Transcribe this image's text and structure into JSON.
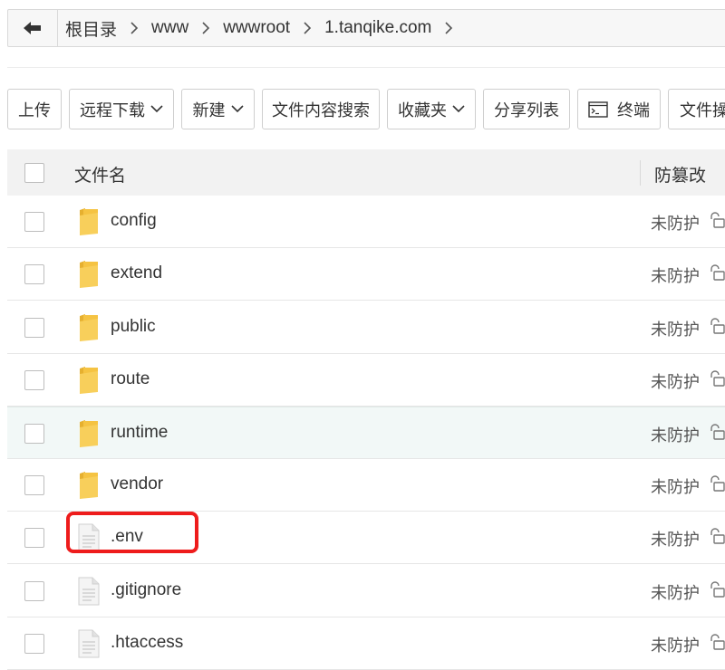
{
  "breadcrumb": {
    "items": [
      "根目录",
      "www",
      "wwwroot",
      "1.tanqike.com"
    ]
  },
  "toolbar": {
    "upload": "上传",
    "remote_download": "远程下载",
    "new": "新建",
    "content_search": "文件内容搜索",
    "favorites": "收藏夹",
    "share_list": "分享列表",
    "terminal": "终端",
    "file_op": "文件操"
  },
  "table": {
    "col_name": "文件名",
    "col_protect": "防篡改",
    "rows": [
      {
        "name": "config",
        "type": "folder",
        "protect": "未防护"
      },
      {
        "name": "extend",
        "type": "folder",
        "protect": "未防护"
      },
      {
        "name": "public",
        "type": "folder",
        "protect": "未防护"
      },
      {
        "name": "route",
        "type": "folder",
        "protect": "未防护"
      },
      {
        "name": "runtime",
        "type": "folder",
        "protect": "未防护"
      },
      {
        "name": "vendor",
        "type": "folder",
        "protect": "未防护"
      },
      {
        "name": ".env",
        "type": "file",
        "protect": "未防护"
      },
      {
        "name": ".gitignore",
        "type": "file",
        "protect": "未防护"
      },
      {
        "name": ".htaccess",
        "type": "file",
        "protect": "未防护"
      }
    ]
  },
  "colors": {
    "highlight": "#ee1c1c",
    "hover_row": "#f2f8f7",
    "folder": "#f5c342"
  },
  "icons": [
    "back-arrow-icon",
    "chevron-right-icon",
    "chevron-down-icon",
    "terminal-icon",
    "folder-icon",
    "file-icon",
    "unlock-icon"
  ]
}
